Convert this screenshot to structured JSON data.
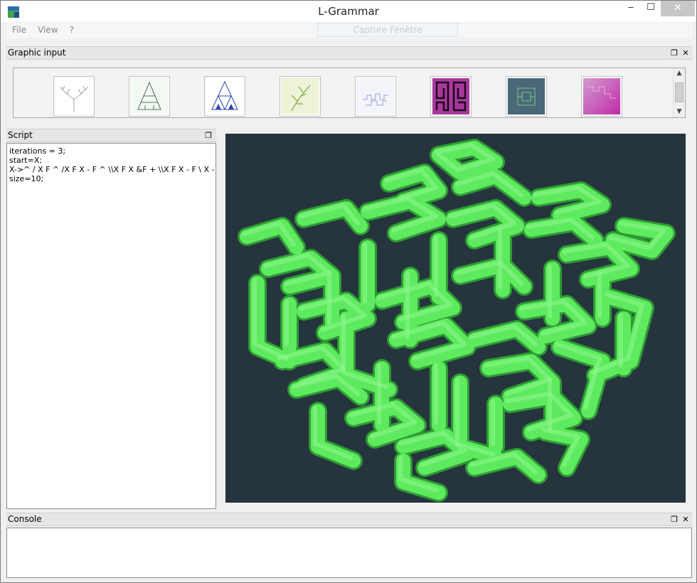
{
  "window": {
    "title": "L-Grammar"
  },
  "titlebar": {
    "minimize": "‒",
    "maximize": "☐",
    "close": "✕"
  },
  "menu": {
    "items": [
      "File",
      "View",
      "?"
    ],
    "capture_label": "Capture Fenêtre"
  },
  "graphic_input": {
    "title": "Graphic input",
    "thumbnails": [
      "binary-tree",
      "fractal-tree-triangle",
      "sierpinski-triangle",
      "fern-plant",
      "dragon-curve",
      "hilbert-magenta",
      "3d-hilbert-cube",
      "gosper-magenta"
    ]
  },
  "script": {
    "title": "Script",
    "lines": [
      "iterations = 3;",
      "start=X;",
      "X->^ / X F ^ /X F X - F ^ \\\\X F X &F + \\\\X F X - F \\ X - \\;",
      "size=10;"
    ]
  },
  "console": {
    "title": "Console"
  },
  "icons": {
    "float": "❐",
    "close": "✕"
  },
  "colors": {
    "viewport_bg": "#25343d",
    "tube": "#5eea5e"
  }
}
